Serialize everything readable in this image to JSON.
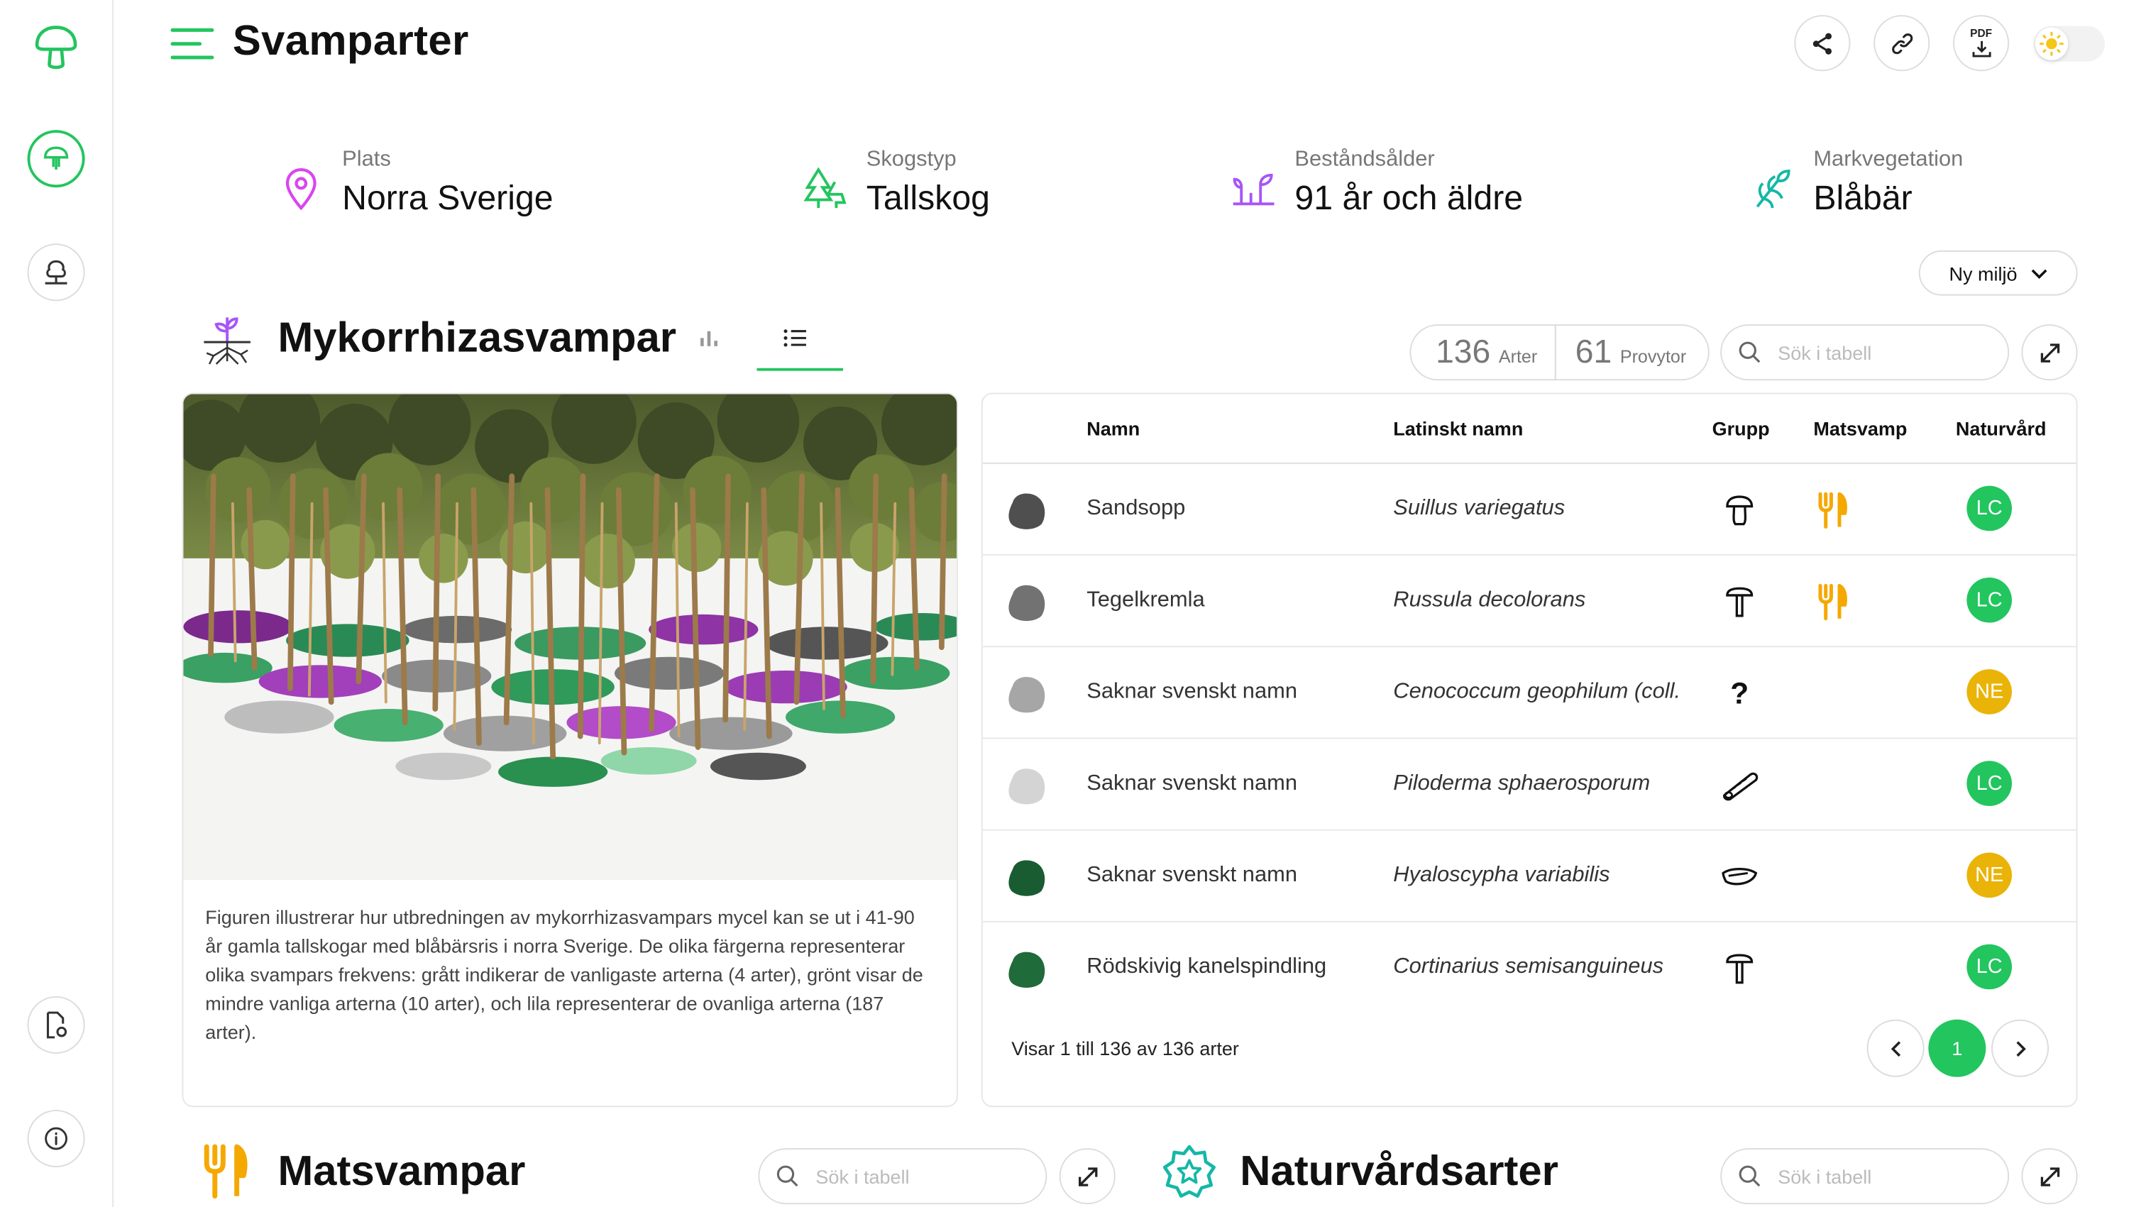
{
  "app": {
    "title": "Svamparter"
  },
  "colors": {
    "accent": "#22c55e",
    "warning": "#eab308",
    "purple": "#a855f7",
    "food": "#f5a800",
    "teal": "#14b8a6"
  },
  "sidebar": {
    "items": [
      {
        "name": "mushroom-logo-icon"
      },
      {
        "name": "fungi-species-icon",
        "active": true
      },
      {
        "name": "forest-tree-icon"
      },
      {
        "name": "document-settings-icon"
      },
      {
        "name": "info-icon"
      }
    ]
  },
  "header": {
    "actions": [
      {
        "name": "share-icon"
      },
      {
        "name": "link-icon"
      },
      {
        "name": "pdf-download-icon",
        "text": "PDF"
      },
      {
        "name": "theme-toggle",
        "icon": "sun-icon"
      }
    ]
  },
  "environment": {
    "place": {
      "label": "Plats",
      "value": "Norra Sverige"
    },
    "forest_type": {
      "label": "Skogstyp",
      "value": "Tallskog"
    },
    "stand_age": {
      "label": "Beståndsålder",
      "value": "91 år och äldre"
    },
    "ground_vegetation": {
      "label": "Markvegetation",
      "value": "Blåbär"
    },
    "new_env_button": "Ny miljö"
  },
  "mycorrhiza": {
    "title": "Mykorrhizasvampar",
    "tabs": [
      {
        "name": "chart-view",
        "icon": "bar-chart-icon"
      },
      {
        "name": "list-view",
        "icon": "list-icon",
        "active": true
      }
    ],
    "species_count": "136",
    "species_unit": "Arter",
    "plots_count": "61",
    "plots_unit": "Provytor",
    "search_placeholder": "Sök i tabell",
    "caption": "Figuren illustrerar hur utbredningen av mykorrhizasvampars mycel kan se ut i 41-90 år gamla tallskogar med blåbärsris i norra Sverige. De olika färgerna representerar olika svampars frekvens: grått indikerar de vanligaste arterna (4 arter), grönt visar de mindre vanliga arterna (10 arter), och lila representerar de ovanliga arterna (187 arter).",
    "table": {
      "columns": [
        "Namn",
        "Latinskt namn",
        "Grupp",
        "Matsvamp",
        "Naturvård"
      ],
      "rows": [
        {
          "name": "Sandsopp",
          "latin": "Suillus variegatus",
          "group_icon": "bolete-icon",
          "edible": true,
          "status": "LC",
          "blob_color": "#4f4f4f"
        },
        {
          "name": "Tegelkremla",
          "latin": "Russula decolorans",
          "group_icon": "gilled-mushroom-icon",
          "edible": true,
          "status": "LC",
          "blob_color": "#727272"
        },
        {
          "name": "Saknar svenskt namn",
          "latin": "Cenococcum geophilum (coll.",
          "group_icon": "question-icon",
          "edible": false,
          "status": "NE",
          "blob_color": "#a6a6a6"
        },
        {
          "name": "Saknar svenskt namn",
          "latin": "Piloderma sphaerosporum",
          "group_icon": "crust-fungus-icon",
          "edible": false,
          "status": "LC",
          "blob_color": "#d4d4d4"
        },
        {
          "name": "Saknar svenskt namn",
          "latin": "Hyaloscypha variabilis",
          "group_icon": "cup-fungus-icon",
          "edible": false,
          "status": "NE",
          "blob_color": "#1a5c32"
        },
        {
          "name": "Rödskivig kanelspindling",
          "latin": "Cortinarius semisanguineus",
          "group_icon": "gilled-mushroom-icon",
          "edible": false,
          "status": "LC",
          "blob_color": "#1f6b3a"
        }
      ],
      "footer": "Visar 1 till 136 av 136 arter",
      "page": "1"
    }
  },
  "food": {
    "title": "Matsvampar",
    "search_placeholder": "Sök i tabell"
  },
  "conservation": {
    "title": "Naturvårdsarter",
    "search_placeholder": "Sök i tabell"
  }
}
